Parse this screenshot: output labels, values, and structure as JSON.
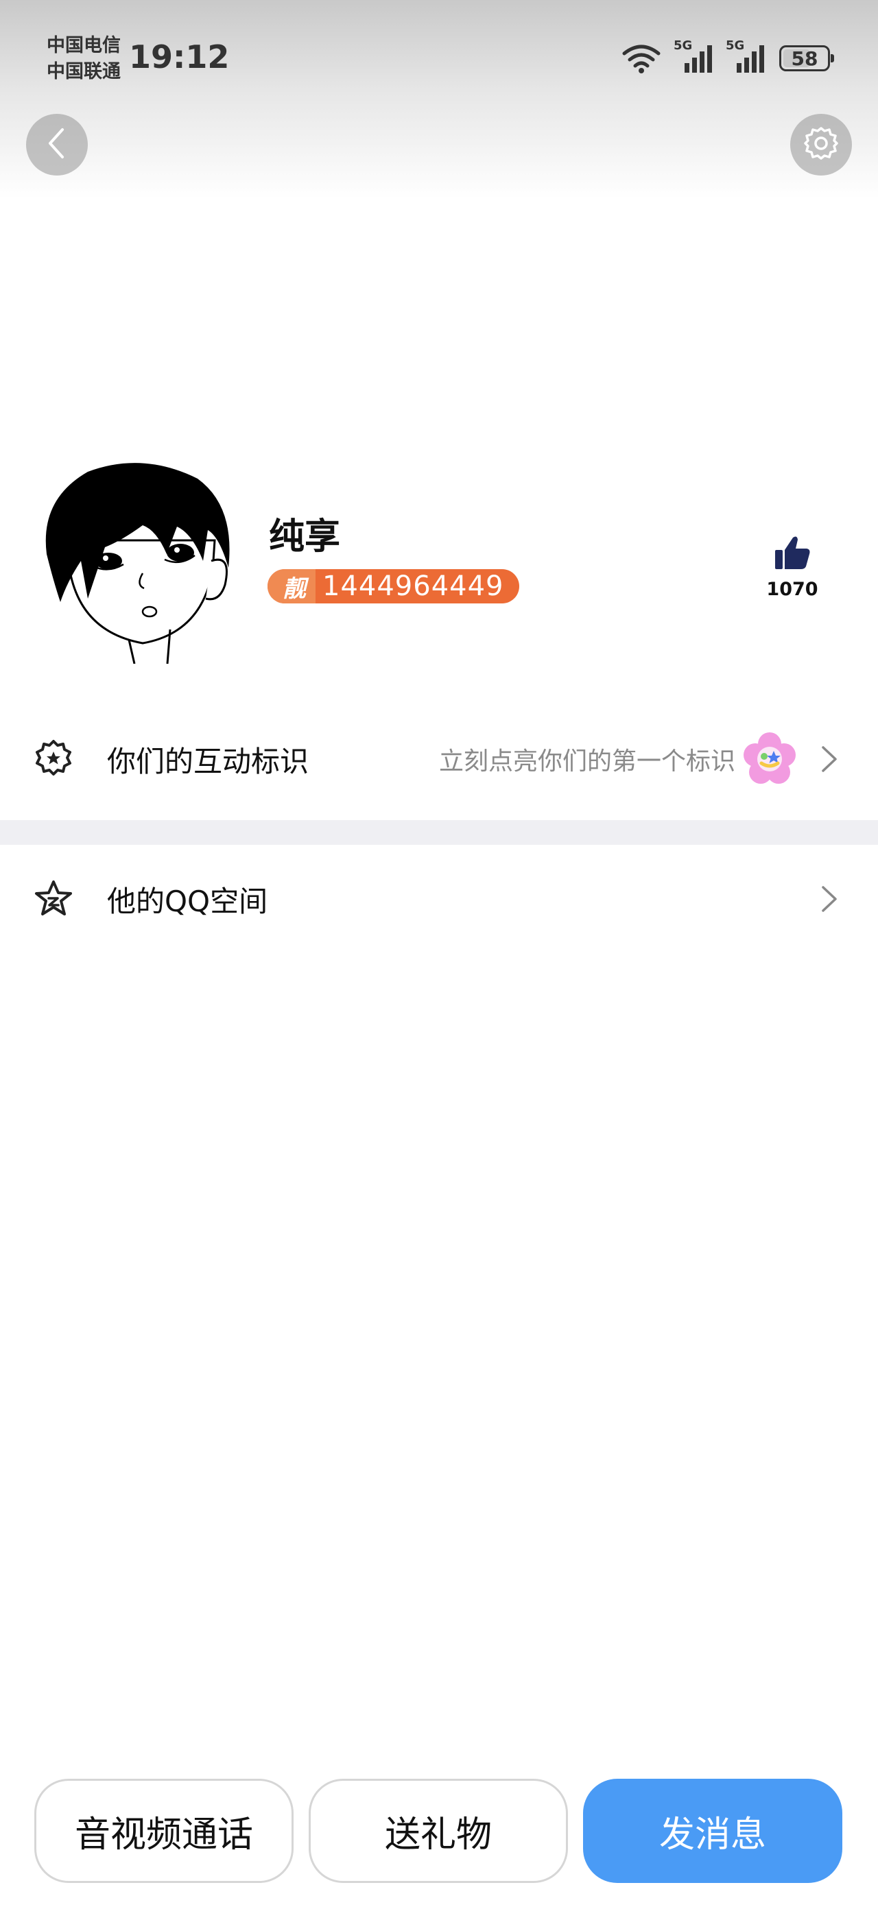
{
  "status_bar": {
    "carrier_1": "中国电信",
    "carrier_2": "中国联通",
    "time": "19:12",
    "network_1": "5G",
    "network_2": "5G",
    "battery": "58",
    "icons": [
      "wifi-icon",
      "signal-icon",
      "signal-icon",
      "battery-icon"
    ]
  },
  "header": {
    "back_icon": "chevron-left-icon",
    "settings_icon": "gear-icon"
  },
  "profile": {
    "nickname": "纯享",
    "badge_tag": "靓",
    "qq_number": "1444964449",
    "likes": "1070",
    "like_icon": "thumbs-up-icon"
  },
  "rows": {
    "interaction": {
      "label": "你们的互动标识",
      "hint": "立刻点亮你们的第一个标识",
      "icon": "badge-star-icon"
    },
    "qzone": {
      "label": "他的QQ空间",
      "icon": "qzone-star-icon"
    }
  },
  "actions": {
    "call": "音视频通话",
    "gift": "送礼物",
    "message": "发消息"
  },
  "colors": {
    "accent_blue": "#4a9bf5",
    "badge_orange": "#ec6b35",
    "like_navy": "#1f2a5e",
    "divider": "#efeff3"
  }
}
